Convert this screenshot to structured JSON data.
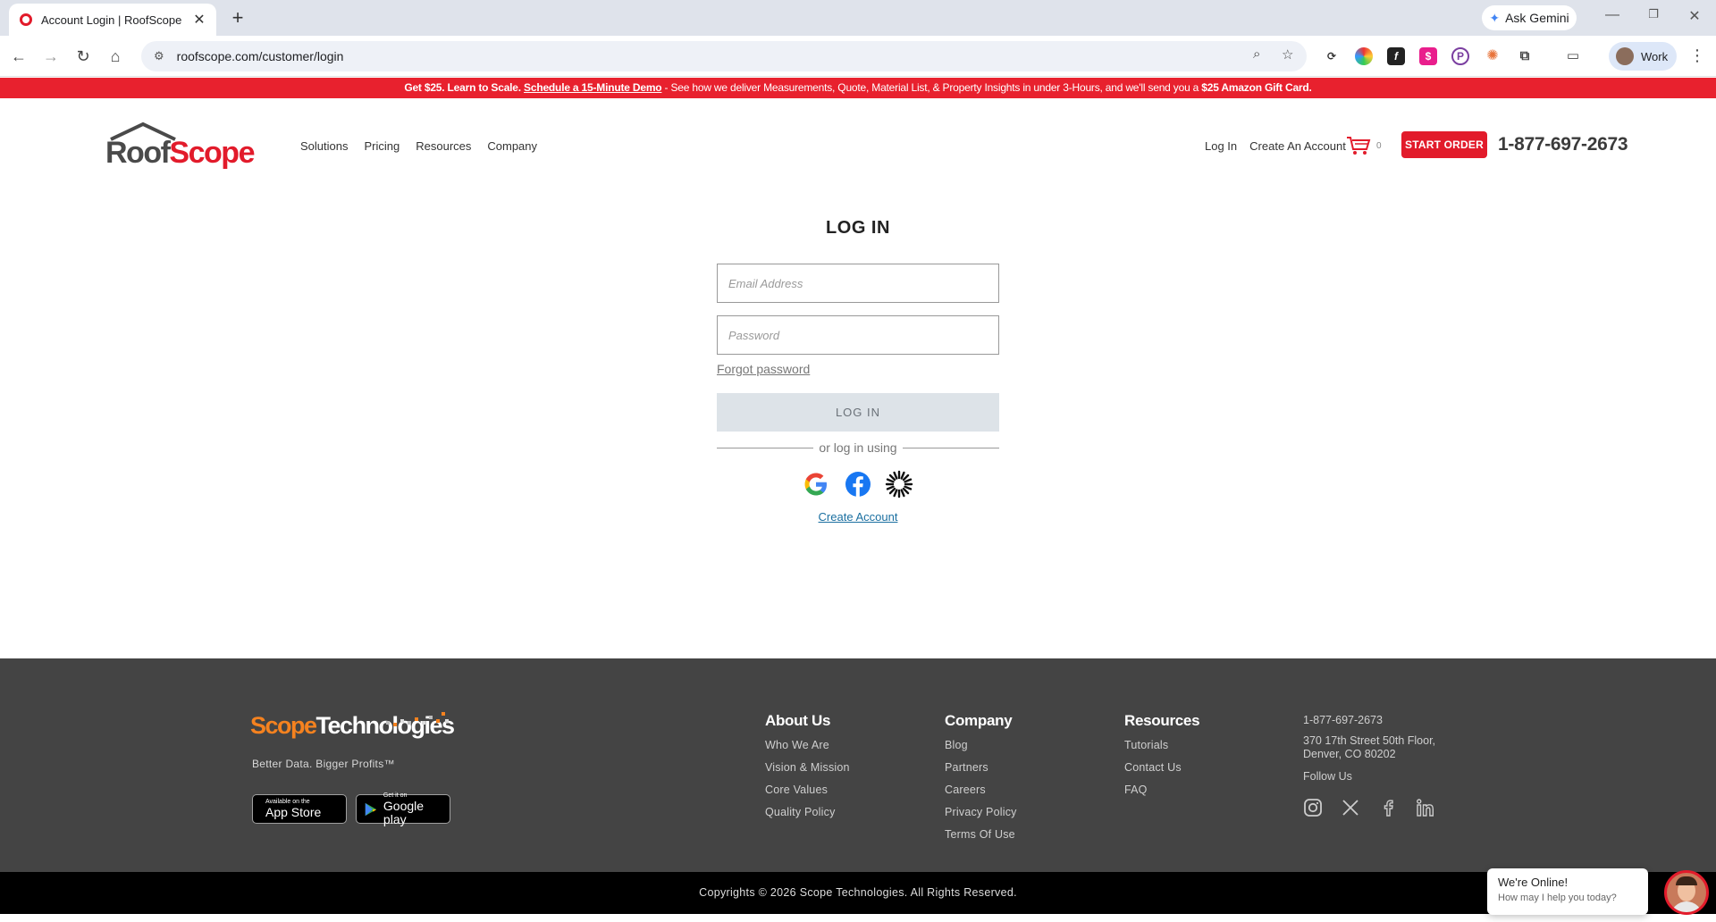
{
  "browser": {
    "tab_title": "Account Login | RoofScope",
    "url": "roofscope.com/customer/login",
    "gemini_label": "Ask Gemini",
    "profile_label": "Work"
  },
  "promo": {
    "lead": "Get $25. Learn to Scale.",
    "link": "Schedule a 15-Minute Demo",
    "middle": " - See how we deliver Measurements, Quote, Material List, & Property Insights in under 3-Hours, and we'll send you a ",
    "reward": "$25 Amazon Gift Card."
  },
  "header": {
    "logo_text_a": "Roof",
    "logo_text_b": "Sc",
    "logo_text_c": "o",
    "logo_text_d": "pe",
    "nav": [
      "Solutions",
      "Pricing",
      "Resources",
      "Company"
    ],
    "login_link": "Log In",
    "create_link": "Create An Account",
    "cart_count": "0",
    "start_order": "START ORDER",
    "phone": "1-877-697-2673"
  },
  "login": {
    "title": "LOG IN",
    "email_placeholder": "Email Address",
    "password_placeholder": "Password",
    "forgot": "Forgot password",
    "button": "LOG IN",
    "divider": "or log in using",
    "create_account": "Create Account"
  },
  "footer": {
    "brand_a": "Sc",
    "brand_b": "o",
    "brand_c": "pe",
    "brand_d": "Technologies",
    "tagline": "Better Data. Bigger Profits™",
    "appstore_small": "Available on the",
    "appstore_big": "App Store",
    "googleplay_small": "Get it on",
    "googleplay_big": "Google play",
    "about": {
      "heading": "About Us",
      "items": [
        "Who We Are",
        "Vision & Mission",
        "Core Values",
        "Quality Policy"
      ]
    },
    "company": {
      "heading": "Company",
      "items": [
        "Blog",
        "Partners",
        "Careers",
        "Privacy Policy",
        "Terms Of Use"
      ]
    },
    "resources": {
      "heading": "Resources",
      "items": [
        "Tutorials",
        "Contact Us",
        "FAQ"
      ]
    },
    "contact": {
      "phone": "1-877-697-2673",
      "address_line1": "370 17th Street 50th Floor,",
      "address_line2": "Denver, CO 80202",
      "follow": "Follow Us"
    },
    "copyright": "Copyrights © 2026 Scope Technologies. All Rights Reserved."
  },
  "chat": {
    "title": "We're Online!",
    "subtitle": "How may I help you today?"
  },
  "colors": {
    "brand_red": "#e21b2b",
    "footer_bg": "#444444",
    "accent_orange": "#f5821f"
  }
}
